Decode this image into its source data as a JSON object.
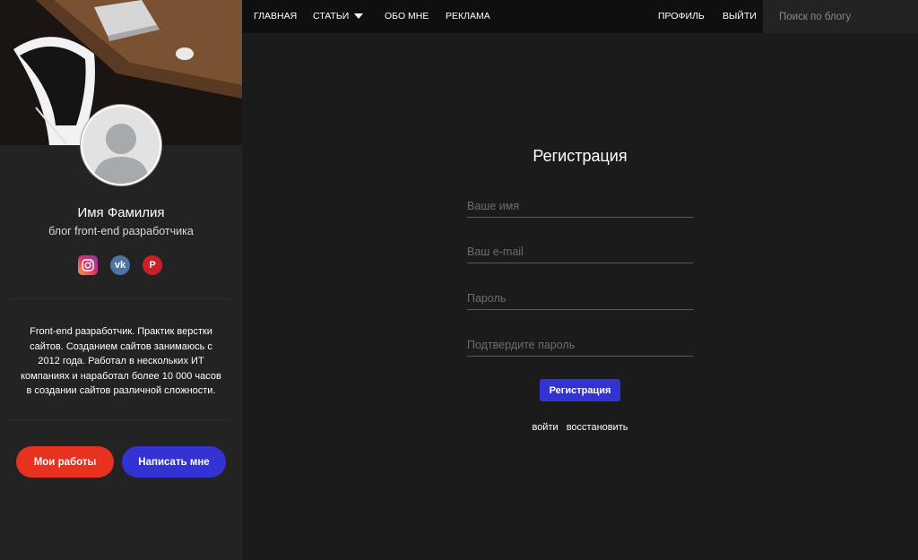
{
  "nav": {
    "home": "ГЛАВНАЯ",
    "articles": "СТАТЬИ",
    "about": "ОБО МНЕ",
    "ads": "РЕКЛАМА",
    "profile": "ПРОФИЛЬ",
    "logout": "ВЫЙТИ",
    "search_placeholder": "Поиск по блогу"
  },
  "sidebar": {
    "name": "Имя Фамилия",
    "subtitle": "блог front-end разработчика",
    "socials": [
      {
        "icon": "instagram-icon",
        "glyph": "◎"
      },
      {
        "icon": "vk-icon",
        "glyph": "vk"
      },
      {
        "icon": "pinterest-icon",
        "glyph": "P"
      }
    ],
    "about": "Front-end разработчик. Практик верстки сайтов. Созданием сайтов занимаюсь с 2012 года. Работал в нескольких ИТ компаниях и наработал более 10 000 часов в создании сайтов различной сложности.",
    "btn_works": "Мои работы",
    "btn_write": "Написать мне"
  },
  "form": {
    "title": "Регистрация",
    "name_placeholder": "Ваше имя",
    "email_placeholder": "Ваш e-mail",
    "password_placeholder": "Пароль",
    "confirm_placeholder": "Подтвердите пароль",
    "submit": "Регистрация",
    "link_login": "войти",
    "link_restore": "восстановить"
  },
  "colors": {
    "accent_blue": "#3333d4",
    "accent_red": "#e8311f",
    "background": "#1b1b1b",
    "sidebar": "#232323",
    "nav": "#0f0f0f"
  }
}
